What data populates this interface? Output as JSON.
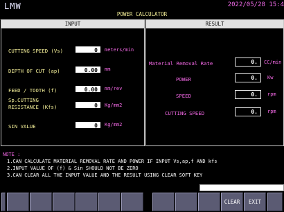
{
  "app": {
    "title": "LMW",
    "datetime": "2022/05/28 15:4",
    "calculator_title": "POWER CALCULATOR"
  },
  "input": {
    "header": "INPUT",
    "fields": [
      {
        "label": "CUTTING SPEED (Vs)",
        "value": "0",
        "unit": "meters/min"
      },
      {
        "label": "DEPTH OF CUT (ap)",
        "value": "0.00",
        "unit": "mm"
      },
      {
        "label": "FEED / TOOTH (f)",
        "value": "0.00",
        "unit": "mm/rev"
      },
      {
        "label_line1": "Sp.CUTTING",
        "label_line2": "RESISTANCE (Kfs)",
        "value": "0",
        "unit": "Kg/mm2"
      },
      {
        "label": "SIN VALUE",
        "value": "0",
        "unit": "Kg/mm2"
      }
    ]
  },
  "result": {
    "header": "RESULT",
    "rows": [
      {
        "label": "Material Removal Rate",
        "value": "0.",
        "unit": "CC/min"
      },
      {
        "label": "POWER",
        "value": "0.",
        "unit": "Kw"
      },
      {
        "label": "SPEED",
        "value": "0.",
        "unit": "rpm"
      },
      {
        "label": "CUTTING SPEED",
        "value": "0.",
        "unit": "rpm"
      }
    ]
  },
  "notes": {
    "heading": "NOTE :",
    "lines": [
      "1.CAN CALCULATE MATERIAL REMOVAL RATE AND POWER IF INPUT Vs,ap,f AND kfs",
      "2.INPUT VALUE OF (f) & Sin SHOULD NOT BE ZERO",
      "3.CAN CLEAR ALL THE INPUT VALUE AND THE RESULT USING CLEAR SOFT KEY"
    ]
  },
  "softkeys": {
    "clear_label": "CLEAR",
    "exit_label": "EXIT"
  },
  "colors": {
    "yellow": "#f7f29a",
    "magenta": "#f76ae9",
    "softkey": "#5b5b73"
  }
}
